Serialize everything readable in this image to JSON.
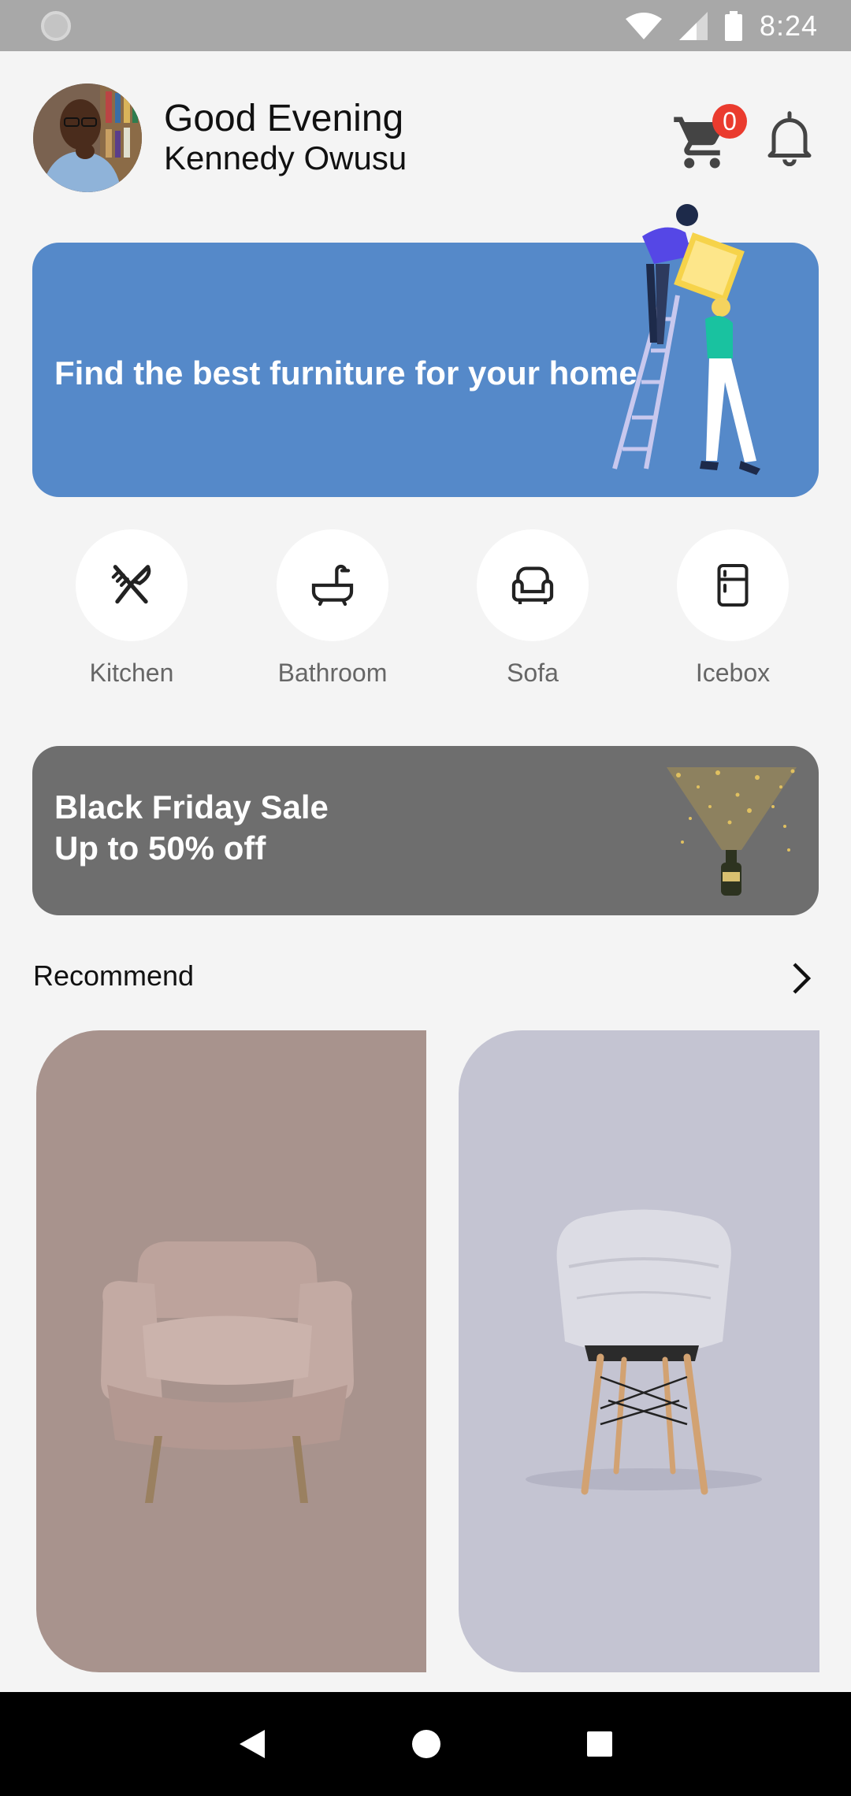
{
  "status_bar": {
    "time": "8:24"
  },
  "header": {
    "greeting": "Good Evening",
    "user_name": "Kennedy Owusu",
    "cart_count": "0"
  },
  "hero": {
    "text": "Find the best furniture for your home",
    "color": "#5589c9"
  },
  "categories": [
    {
      "label": "Kitchen",
      "icon": "kitchen-icon"
    },
    {
      "label": "Bathroom",
      "icon": "bathtub-icon"
    },
    {
      "label": "Sofa",
      "icon": "sofa-icon"
    },
    {
      "label": "Icebox",
      "icon": "fridge-icon"
    }
  ],
  "sale": {
    "line1": "Black Friday Sale",
    "line2": "Up to 50% off",
    "color": "#6e6e6e"
  },
  "recommend": {
    "title": "Recommend",
    "products": [
      {
        "icon": "armchair-image",
        "bg": "#a8938d"
      },
      {
        "icon": "eames-chair-image",
        "bg": "#c4c4d2"
      }
    ]
  },
  "colors": {
    "badge": "#ea3b2e",
    "background": "#f4f4f4"
  }
}
